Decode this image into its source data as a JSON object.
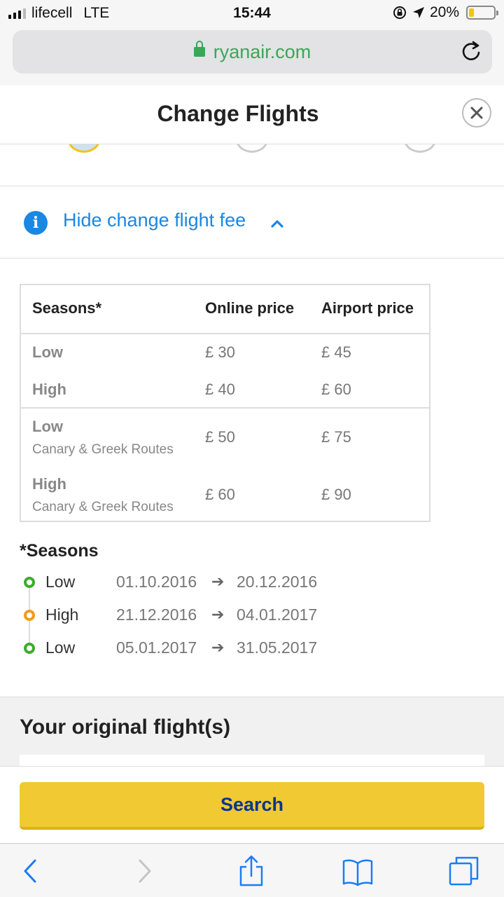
{
  "status_bar": {
    "carrier": "lifecell",
    "network": "LTE",
    "time": "15:44",
    "battery": "20%",
    "battery_level": 0.2
  },
  "browser": {
    "url": "ryanair.com"
  },
  "dialog": {
    "title": "Change Flights",
    "close_icon": "close-icon"
  },
  "fee_toggle": {
    "label": "Hide change flight fee"
  },
  "fee_table": {
    "headers": [
      "Seasons*",
      "Online price",
      "Airport price"
    ],
    "rows": [
      {
        "season": "Low",
        "sub": "",
        "online": "£ 30",
        "airport": "£ 45"
      },
      {
        "season": "High",
        "sub": "",
        "online": "£ 40",
        "airport": "£ 60"
      },
      {
        "season": "Low",
        "sub": "Canary & Greek Routes",
        "online": "£ 50",
        "airport": "£ 75"
      },
      {
        "season": "High",
        "sub": "Canary & Greek Routes",
        "online": "£ 60",
        "airport": "£ 90"
      }
    ]
  },
  "seasons": {
    "title": "*Seasons",
    "items": [
      {
        "name": "Low",
        "from": "01.10.2016",
        "to": "20.12.2016",
        "color": "#3dab2e"
      },
      {
        "name": "High",
        "from": "21.12.2016",
        "to": "04.01.2017",
        "color": "#f29a1b"
      },
      {
        "name": "Low",
        "from": "05.01.2017",
        "to": "31.05.2017",
        "color": "#3dab2e"
      }
    ]
  },
  "original_flights": {
    "title": "Your original flight(s)"
  },
  "search": {
    "label": "Search"
  },
  "colors": {
    "accent_blue": "#1a87e3",
    "ryanair_yellow": "#f1c933",
    "ryanair_navy": "#073590",
    "secure_green": "#3aa757"
  }
}
